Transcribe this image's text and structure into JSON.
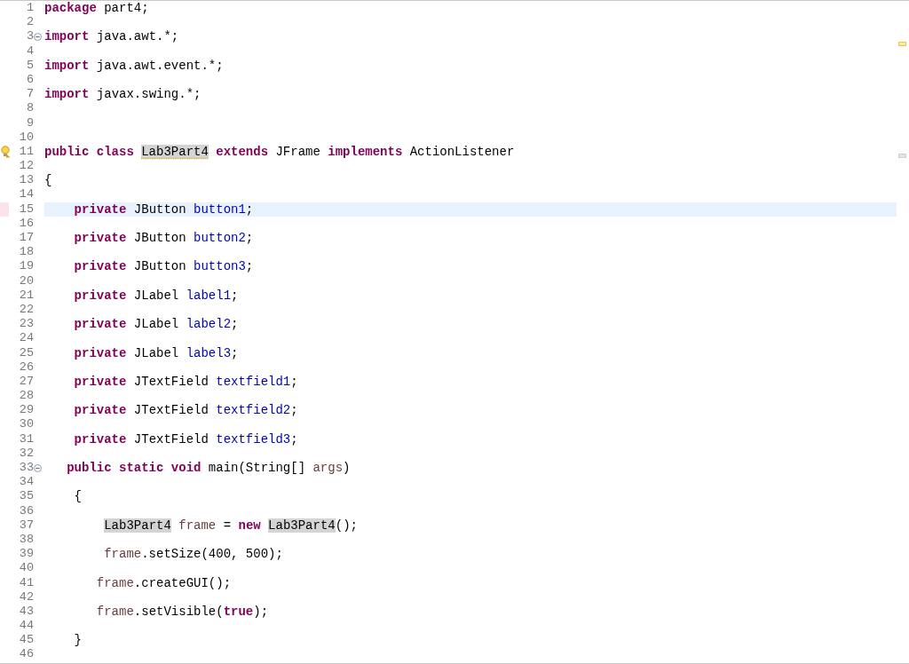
{
  "editor": {
    "lines": [
      {
        "number": "1",
        "tokens": [
          {
            "text": "package",
            "kind": "keyword"
          },
          {
            "text": " part4;",
            "kind": "plain"
          }
        ]
      },
      {
        "number": "2"
      },
      {
        "number": "3",
        "fold": {
          "expanded": true
        },
        "tokens": [
          {
            "text": "import",
            "kind": "keyword"
          },
          {
            "text": " java.awt.*;",
            "kind": "plain"
          }
        ]
      },
      {
        "number": "4"
      },
      {
        "number": "5",
        "tokens": [
          {
            "text": "import",
            "kind": "keyword"
          },
          {
            "text": " java.awt.event.*;",
            "kind": "plain"
          }
        ]
      },
      {
        "number": "6"
      },
      {
        "number": "7",
        "tokens": [
          {
            "text": "import",
            "kind": "keyword"
          },
          {
            "text": " javax.swing.*;",
            "kind": "plain"
          }
        ]
      },
      {
        "number": "8"
      },
      {
        "number": "9"
      },
      {
        "number": "10"
      },
      {
        "number": "11",
        "warning": true,
        "tokens": [
          {
            "text": "public class ",
            "kind": "keyword"
          },
          {
            "text": "Lab3Part4",
            "kind": "plain",
            "occurrence": true,
            "warning": true
          },
          {
            "text": " extends",
            "kind": "keyword"
          },
          {
            "text": " JFrame ",
            "kind": "plain"
          },
          {
            "text": "implements",
            "kind": "keyword"
          },
          {
            "text": " ActionListener",
            "kind": "plain"
          }
        ]
      },
      {
        "number": "12"
      },
      {
        "number": "13",
        "tokens": [
          {
            "text": "{",
            "kind": "plain"
          }
        ]
      },
      {
        "number": "14"
      },
      {
        "number": "15",
        "current": true,
        "tokens": [
          {
            "text": "    private",
            "kind": "keyword"
          },
          {
            "text": " JButton ",
            "kind": "plain"
          },
          {
            "text": "button1",
            "kind": "field"
          },
          {
            "text": ";",
            "kind": "plain"
          }
        ]
      },
      {
        "number": "16"
      },
      {
        "number": "17",
        "tokens": [
          {
            "text": "    private",
            "kind": "keyword"
          },
          {
            "text": " JButton ",
            "kind": "plain"
          },
          {
            "text": "button2",
            "kind": "field"
          },
          {
            "text": ";",
            "kind": "plain"
          }
        ]
      },
      {
        "number": "18"
      },
      {
        "number": "19",
        "tokens": [
          {
            "text": "    private",
            "kind": "keyword"
          },
          {
            "text": " JButton ",
            "kind": "plain"
          },
          {
            "text": "button3",
            "kind": "field"
          },
          {
            "text": ";",
            "kind": "plain"
          }
        ]
      },
      {
        "number": "20"
      },
      {
        "number": "21",
        "tokens": [
          {
            "text": "    private",
            "kind": "keyword"
          },
          {
            "text": " JLabel ",
            "kind": "plain"
          },
          {
            "text": "label1",
            "kind": "field"
          },
          {
            "text": ";",
            "kind": "plain"
          }
        ]
      },
      {
        "number": "22"
      },
      {
        "number": "23",
        "tokens": [
          {
            "text": "    private",
            "kind": "keyword"
          },
          {
            "text": " JLabel ",
            "kind": "plain"
          },
          {
            "text": "label2",
            "kind": "field"
          },
          {
            "text": ";",
            "kind": "plain"
          }
        ]
      },
      {
        "number": "24"
      },
      {
        "number": "25",
        "tokens": [
          {
            "text": "    private",
            "kind": "keyword"
          },
          {
            "text": " JLabel ",
            "kind": "plain"
          },
          {
            "text": "label3",
            "kind": "field"
          },
          {
            "text": ";",
            "kind": "plain"
          }
        ]
      },
      {
        "number": "26"
      },
      {
        "number": "27",
        "tokens": [
          {
            "text": "    private",
            "kind": "keyword"
          },
          {
            "text": " JTextField ",
            "kind": "plain"
          },
          {
            "text": "textfield1",
            "kind": "field"
          },
          {
            "text": ";",
            "kind": "plain"
          }
        ]
      },
      {
        "number": "28"
      },
      {
        "number": "29",
        "tokens": [
          {
            "text": "    private",
            "kind": "keyword"
          },
          {
            "text": " JTextField ",
            "kind": "plain"
          },
          {
            "text": "textfield2",
            "kind": "field"
          },
          {
            "text": ";",
            "kind": "plain"
          }
        ]
      },
      {
        "number": "30"
      },
      {
        "number": "31",
        "tokens": [
          {
            "text": "    private",
            "kind": "keyword"
          },
          {
            "text": " JTextField ",
            "kind": "plain"
          },
          {
            "text": "textfield3",
            "kind": "field"
          },
          {
            "text": ";",
            "kind": "plain"
          }
        ]
      },
      {
        "number": "32"
      },
      {
        "number": "33",
        "fold": {
          "expanded": true
        },
        "tokens": [
          {
            "text": "   public static void",
            "kind": "keyword"
          },
          {
            "text": " main(String[] ",
            "kind": "plain"
          },
          {
            "text": "args",
            "kind": "local"
          },
          {
            "text": ")",
            "kind": "plain"
          }
        ]
      },
      {
        "number": "34"
      },
      {
        "number": "35",
        "tokens": [
          {
            "text": "    {",
            "kind": "plain"
          }
        ]
      },
      {
        "number": "36"
      },
      {
        "number": "37",
        "tokens": [
          {
            "text": "        Lab3Part4",
            "kind": "plain",
            "occurrence": true
          },
          {
            "text": " frame",
            "kind": "local"
          },
          {
            "text": " = ",
            "kind": "plain"
          },
          {
            "text": "new",
            "kind": "keyword"
          },
          {
            "text": " Lab3Part4",
            "kind": "plain",
            "occurrence": true
          },
          {
            "text": "();",
            "kind": "plain"
          }
        ]
      },
      {
        "number": "38"
      },
      {
        "number": "39",
        "tokens": [
          {
            "text": "        frame",
            "kind": "local"
          },
          {
            "text": ".setSize(400, 500);",
            "kind": "plain"
          }
        ]
      },
      {
        "number": "40"
      },
      {
        "number": "41",
        "tokens": [
          {
            "text": "       frame",
            "kind": "local"
          },
          {
            "text": ".createGUI();",
            "kind": "plain"
          }
        ]
      },
      {
        "number": "42"
      },
      {
        "number": "43",
        "tokens": [
          {
            "text": "       frame",
            "kind": "local"
          },
          {
            "text": ".setVisible(",
            "kind": "plain"
          },
          {
            "text": "true",
            "kind": "keyword"
          },
          {
            "text": ");",
            "kind": "plain"
          }
        ]
      },
      {
        "number": "44"
      },
      {
        "number": "45",
        "tokens": [
          {
            "text": "    }",
            "kind": "plain"
          }
        ]
      },
      {
        "number": "46"
      }
    ],
    "overview_ruler": [
      {
        "kind": "warning"
      },
      {
        "kind": "occurrence"
      }
    ]
  }
}
